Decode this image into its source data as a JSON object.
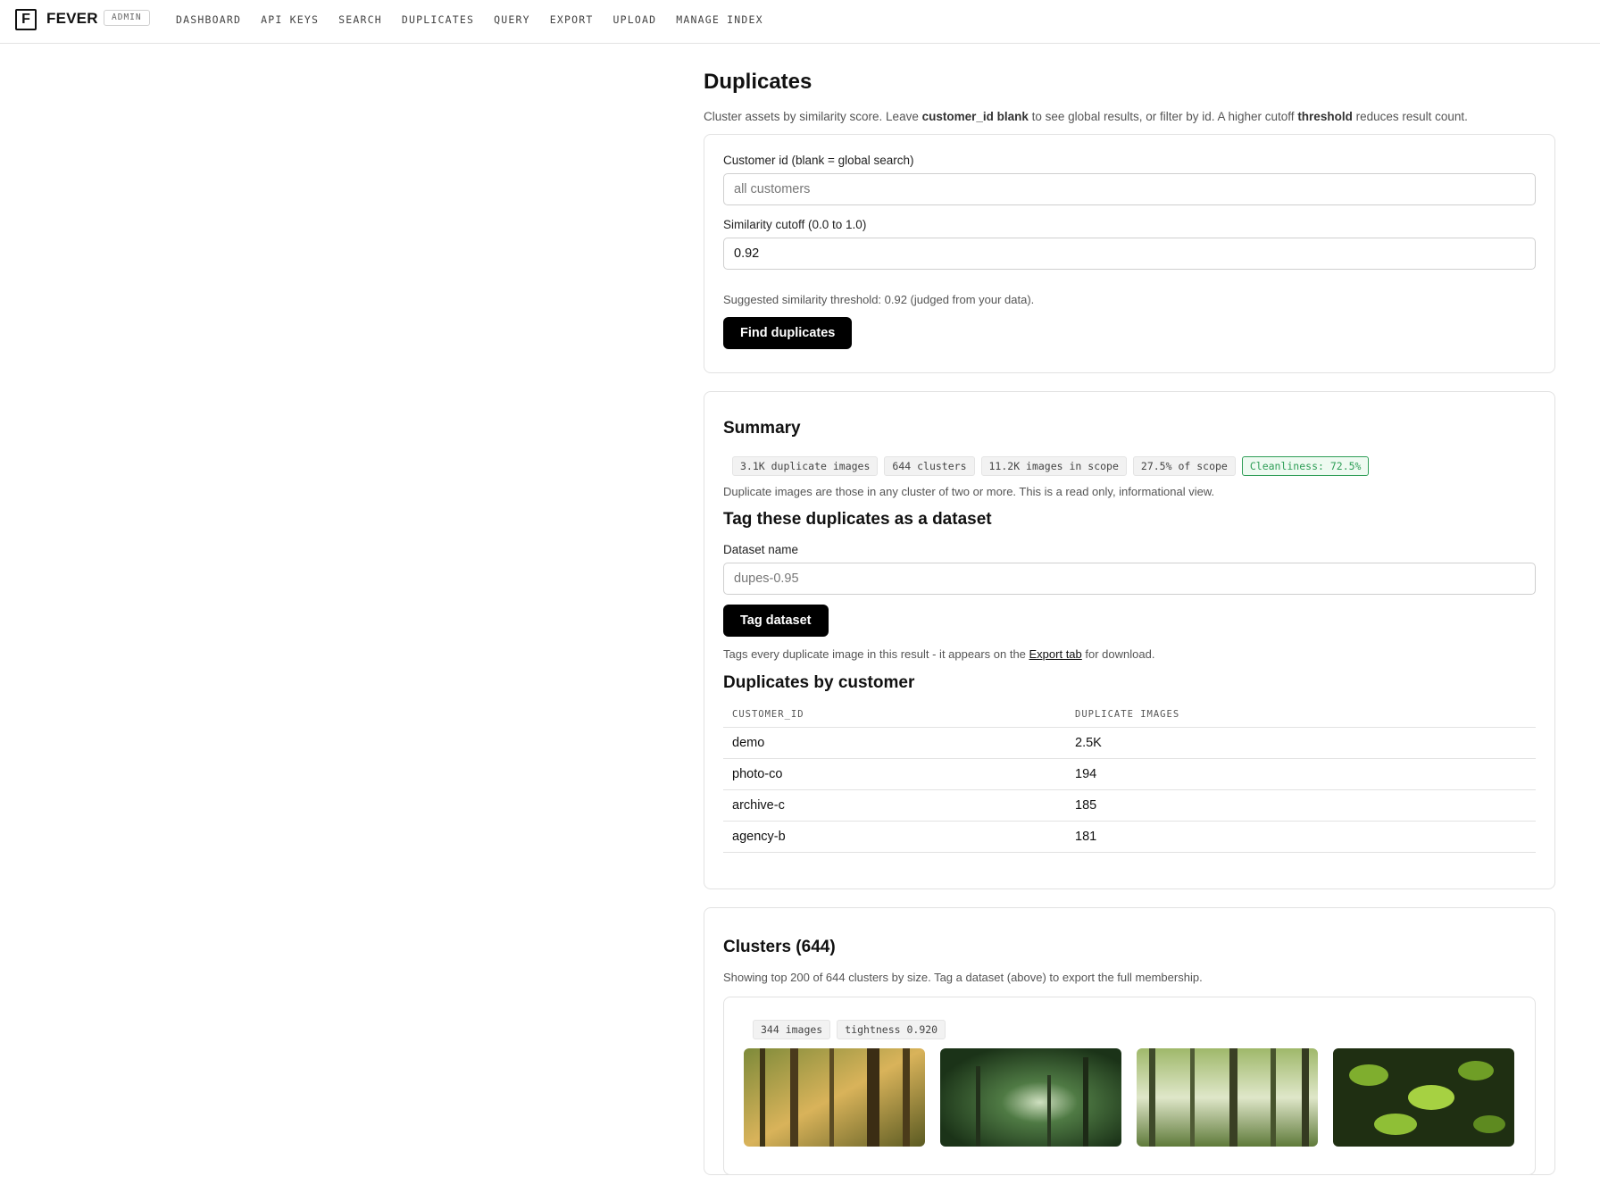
{
  "app": {
    "brand": "FEVER",
    "badge": "ADMIN",
    "logo_letter": "F"
  },
  "nav": [
    "DASHBOARD",
    "API KEYS",
    "SEARCH",
    "DUPLICATES",
    "QUERY",
    "EXPORT",
    "UPLOAD",
    "MANAGE INDEX"
  ],
  "page": {
    "title": "Duplicates",
    "intro_pre": "Cluster assets by similarity score. Leave ",
    "intro_b1": "customer_id blank",
    "intro_mid": " to see global results, or filter by id. A higher cutoff ",
    "intro_b2": "threshold",
    "intro_post": " reduces result count."
  },
  "form": {
    "customer_label": "Customer id (blank = global search)",
    "customer_placeholder": "all customers",
    "cutoff_label": "Similarity cutoff (0.0 to 1.0)",
    "cutoff_value": "0.92",
    "suggestion": "Suggested similarity threshold: 0.92 (judged from your data).",
    "submit_label": "Find duplicates"
  },
  "summary": {
    "title": "Summary",
    "chips": [
      "3.1K duplicate images",
      "644 clusters",
      "11.2K images in scope",
      "27.5% of scope"
    ],
    "cleanliness": "Cleanliness: 72.5%",
    "note": "Duplicate images are those in any cluster of two or more. This is a read only, informational view."
  },
  "tag": {
    "title": "Tag these duplicates as a dataset",
    "label": "Dataset name",
    "placeholder": "dupes-0.95",
    "button": "Tag dataset",
    "note_pre": "Tags every duplicate image in this result - it appears on the ",
    "note_link": "Export tab",
    "note_post": " for download."
  },
  "by_customer": {
    "title": "Duplicates by customer",
    "columns": [
      "CUSTOMER_ID",
      "DUPLICATE IMAGES"
    ],
    "rows": [
      [
        "demo",
        "2.5K"
      ],
      [
        "photo-co",
        "194"
      ],
      [
        "archive-c",
        "185"
      ],
      [
        "agency-b",
        "181"
      ]
    ]
  },
  "clusters": {
    "title": "Clusters (644)",
    "note": "Showing top 200 of 644 clusters by size. Tag a dataset (above) to export the full membership.",
    "first": {
      "chips": [
        "344 images",
        "tightness 0.920"
      ]
    }
  }
}
